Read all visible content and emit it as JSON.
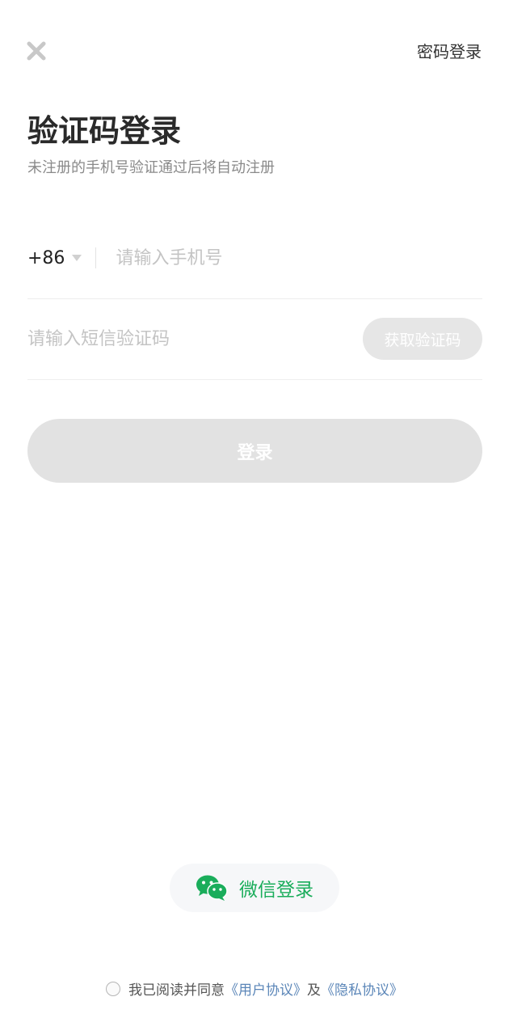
{
  "header": {
    "close_icon": "close-icon",
    "password_login_label": "密码登录"
  },
  "title": "验证码登录",
  "subtitle": "未注册的手机号验证通过后将自动注册",
  "phone": {
    "country_code": "+86",
    "caret_icon": "caret-down-icon",
    "placeholder": "请输入手机号",
    "value": ""
  },
  "code": {
    "placeholder": "请输入短信验证码",
    "value": "",
    "get_code_label": "获取验证码"
  },
  "login_button_label": "登录",
  "wechat": {
    "icon": "wechat-icon",
    "label": "微信登录"
  },
  "agreement": {
    "prefix": "我已阅读并同意",
    "user_agreement": "《用户协议》",
    "conjunction": "及",
    "privacy_agreement": "《隐私协议》"
  },
  "colors": {
    "wechat_green": "#1aad5b",
    "link_blue": "#5b86b8",
    "disabled_button": "#e2e2e2"
  }
}
